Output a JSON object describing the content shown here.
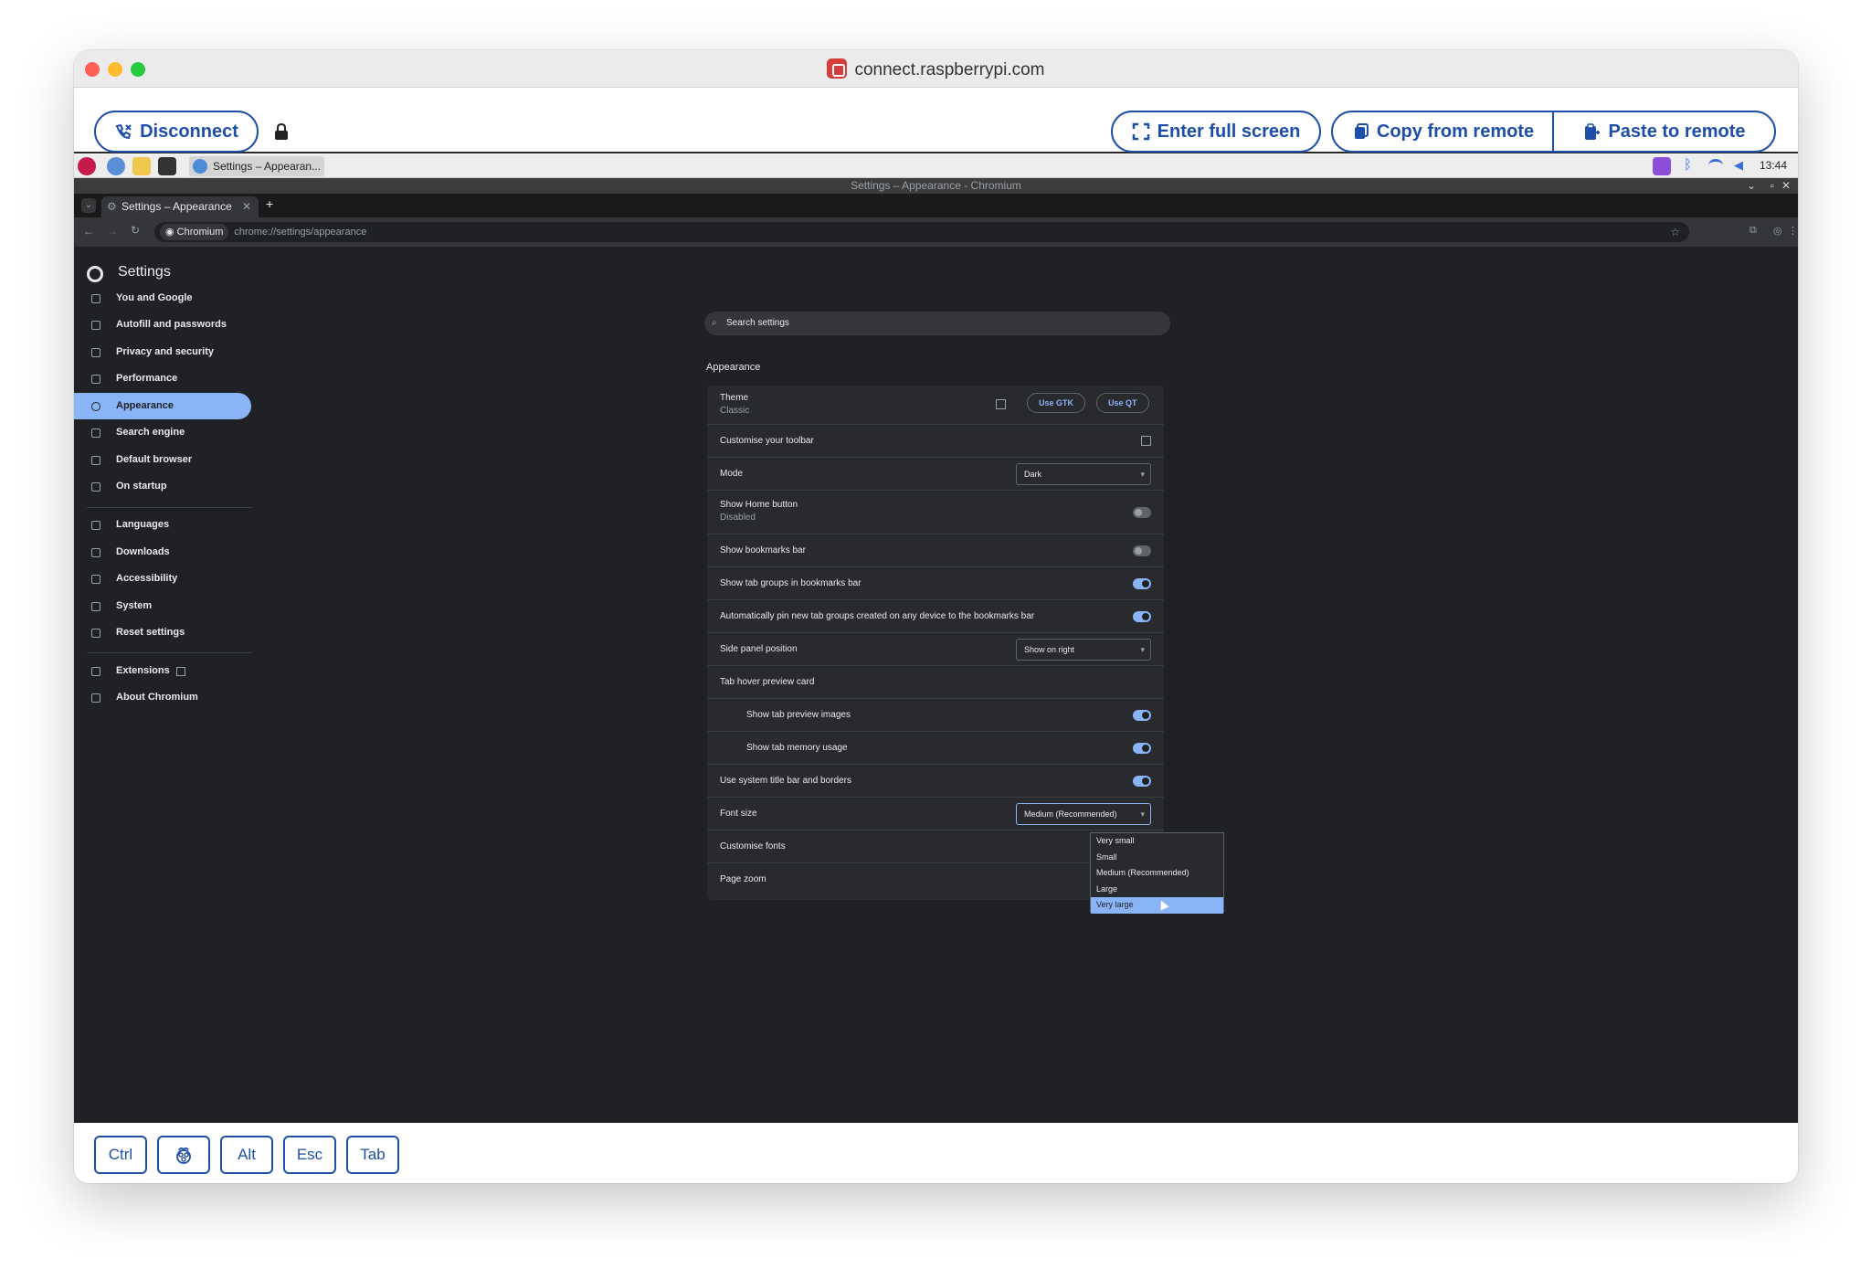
{
  "window": {
    "site": "connect.raspberrypi.com"
  },
  "toolbar": {
    "disconnect": "Disconnect",
    "fullscreen": "Enter full screen",
    "copy": "Copy from remote",
    "paste": "Paste to remote"
  },
  "taskbar": {
    "task": "Settings – Appearan...",
    "time": "13:44"
  },
  "browser": {
    "window_title": "Settings – Appearance - Chromium",
    "tab": "Settings – Appearance",
    "chip": "Chromium",
    "url": "chrome://settings/appearance"
  },
  "settings": {
    "title": "Settings",
    "search_placeholder": "Search settings",
    "nav": [
      "You and Google",
      "Autofill and passwords",
      "Privacy and security",
      "Performance",
      "Appearance",
      "Search engine",
      "Default browser",
      "On startup",
      "Languages",
      "Downloads",
      "Accessibility",
      "System",
      "Reset settings",
      "Extensions",
      "About Chromium"
    ],
    "section": "Appearance",
    "theme": {
      "label": "Theme",
      "value": "Classic",
      "gtk": "Use GTK",
      "qt": "Use QT"
    },
    "rows": {
      "toolbar": "Customise your toolbar",
      "mode": "Mode",
      "mode_value": "Dark",
      "home": "Show Home button",
      "home_sub": "Disabled",
      "bookmarks": "Show bookmarks bar",
      "tabgroups": "Show tab groups in bookmarks bar",
      "autopin": "Automatically pin new tab groups created on any device to the bookmarks bar",
      "side": "Side panel position",
      "side_value": "Show on right",
      "hover": "Tab hover preview card",
      "preview_images": "Show tab preview images",
      "memory": "Show tab memory usage",
      "titlebar": "Use system title bar and borders",
      "font": "Font size",
      "font_value": "Medium (Recommended)",
      "fonts": "Customise fonts",
      "zoom": "Page zoom"
    },
    "font_options": [
      "Very small",
      "Small",
      "Medium (Recommended)",
      "Large",
      "Very large"
    ]
  },
  "keys": {
    "ctrl": "Ctrl",
    "alt": "Alt",
    "esc": "Esc",
    "tab": "Tab"
  }
}
